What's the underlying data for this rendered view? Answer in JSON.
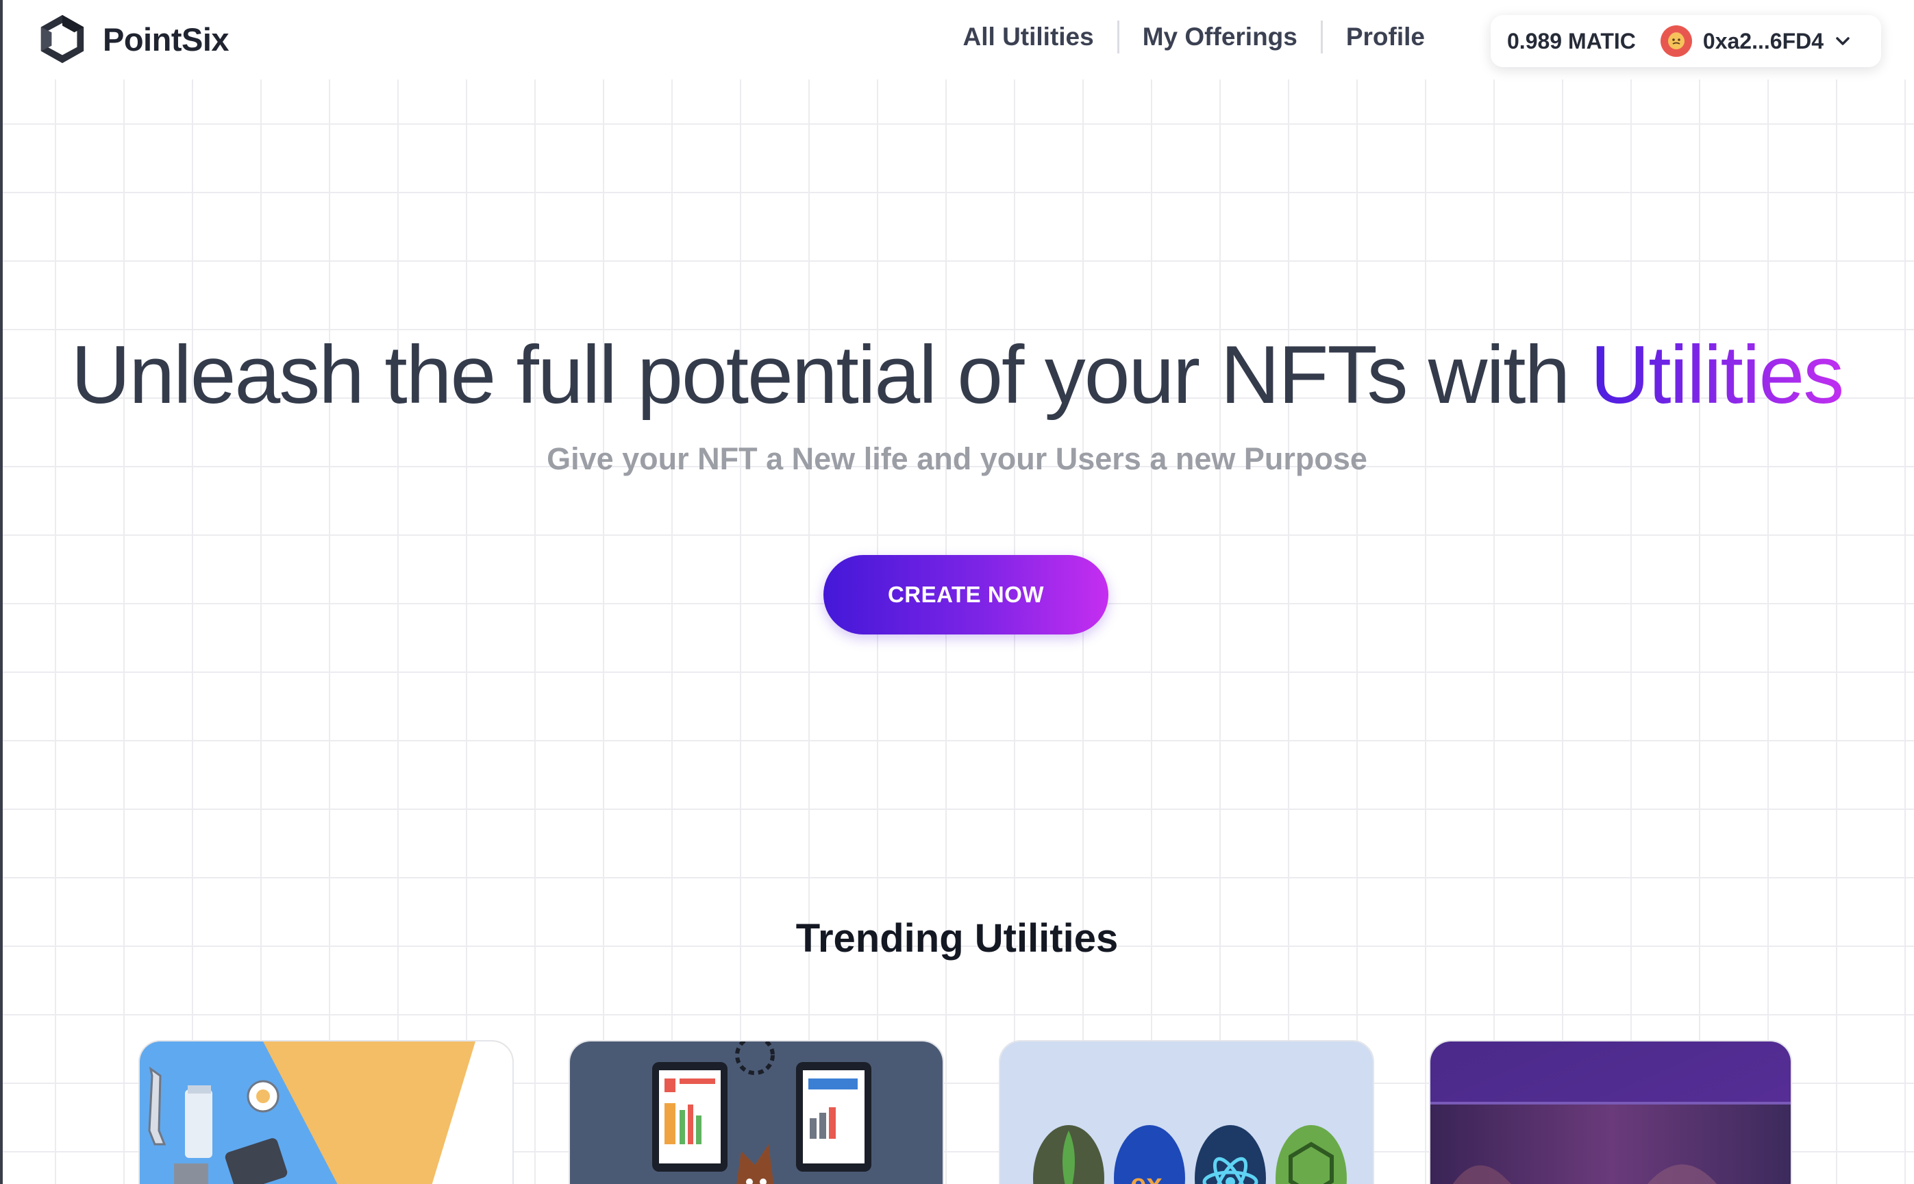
{
  "header": {
    "brand": "PointSix",
    "nav": [
      "All Utilities",
      "My Offerings",
      "Profile"
    ],
    "wallet": {
      "balance": "0.989 MATIC",
      "address": "0xa2...6FD4"
    }
  },
  "hero": {
    "title_main": "Unleash the full potential of your NFTs with ",
    "title_accent": "Utilities",
    "subtitle": "Give your NFT a New life and your Users a new Purpose",
    "cta": "CREATE NOW"
  },
  "trending": {
    "title": "Trending Utilities",
    "cards": [
      {
        "icon": "tools-documents-illustration"
      },
      {
        "icon": "dashboard-screens-illustration"
      },
      {
        "icon": "tech-stack-logos-illustration"
      },
      {
        "icon": "purple-artwork-illustration"
      }
    ]
  },
  "colors": {
    "accent_start": "#4418d8",
    "accent_end": "#c52ef0",
    "text_dark": "#343b4b"
  }
}
